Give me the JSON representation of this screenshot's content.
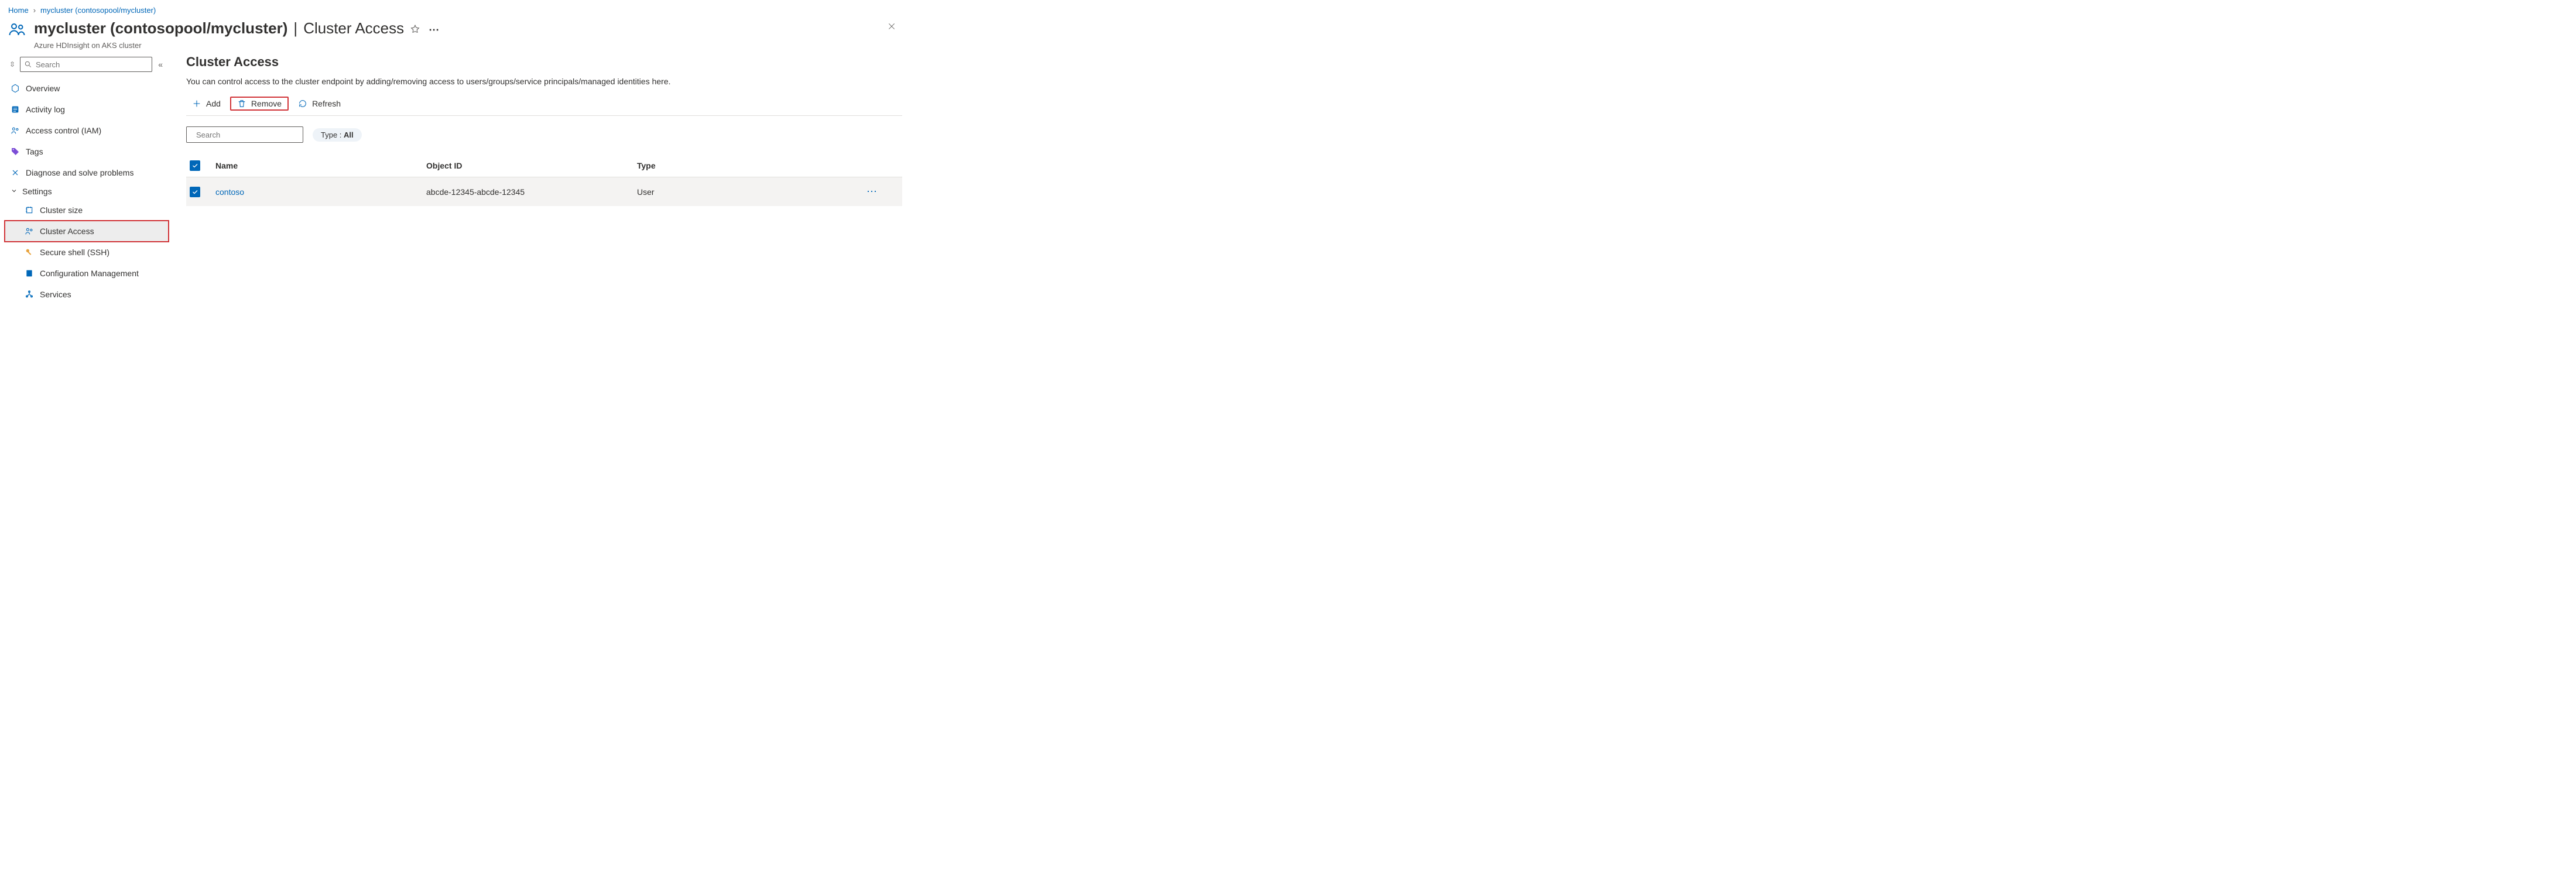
{
  "breadcrumb": {
    "home": "Home",
    "cluster": "mycluster (contosopool/mycluster)"
  },
  "title": {
    "primary": "mycluster (contosopool/mycluster)",
    "secondary": "Cluster Access",
    "subtitle": "Azure HDInsight on AKS cluster"
  },
  "sidebar": {
    "search_placeholder": "Search",
    "items": {
      "overview": "Overview",
      "activity_log": "Activity log",
      "access_control": "Access control (IAM)",
      "tags": "Tags",
      "diagnose": "Diagnose and solve problems"
    },
    "settings_header": "Settings",
    "settings": {
      "cluster_size": "Cluster size",
      "cluster_access": "Cluster Access",
      "secure_shell": "Secure shell (SSH)",
      "config_mgmt": "Configuration Management",
      "services": "Services"
    }
  },
  "main": {
    "heading": "Cluster Access",
    "description": "You can control access to the cluster endpoint by adding/removing access to users/groups/service principals/managed identities here.",
    "toolbar": {
      "add": "Add",
      "remove": "Remove",
      "refresh": "Refresh"
    },
    "filter": {
      "search_placeholder": "Search",
      "type_label": "Type : ",
      "type_value": "All"
    },
    "table": {
      "headers": {
        "name": "Name",
        "object_id": "Object ID",
        "type": "Type"
      },
      "rows": [
        {
          "name": "contoso",
          "object_id": "abcde-12345-abcde-12345",
          "type": "User"
        }
      ]
    }
  }
}
